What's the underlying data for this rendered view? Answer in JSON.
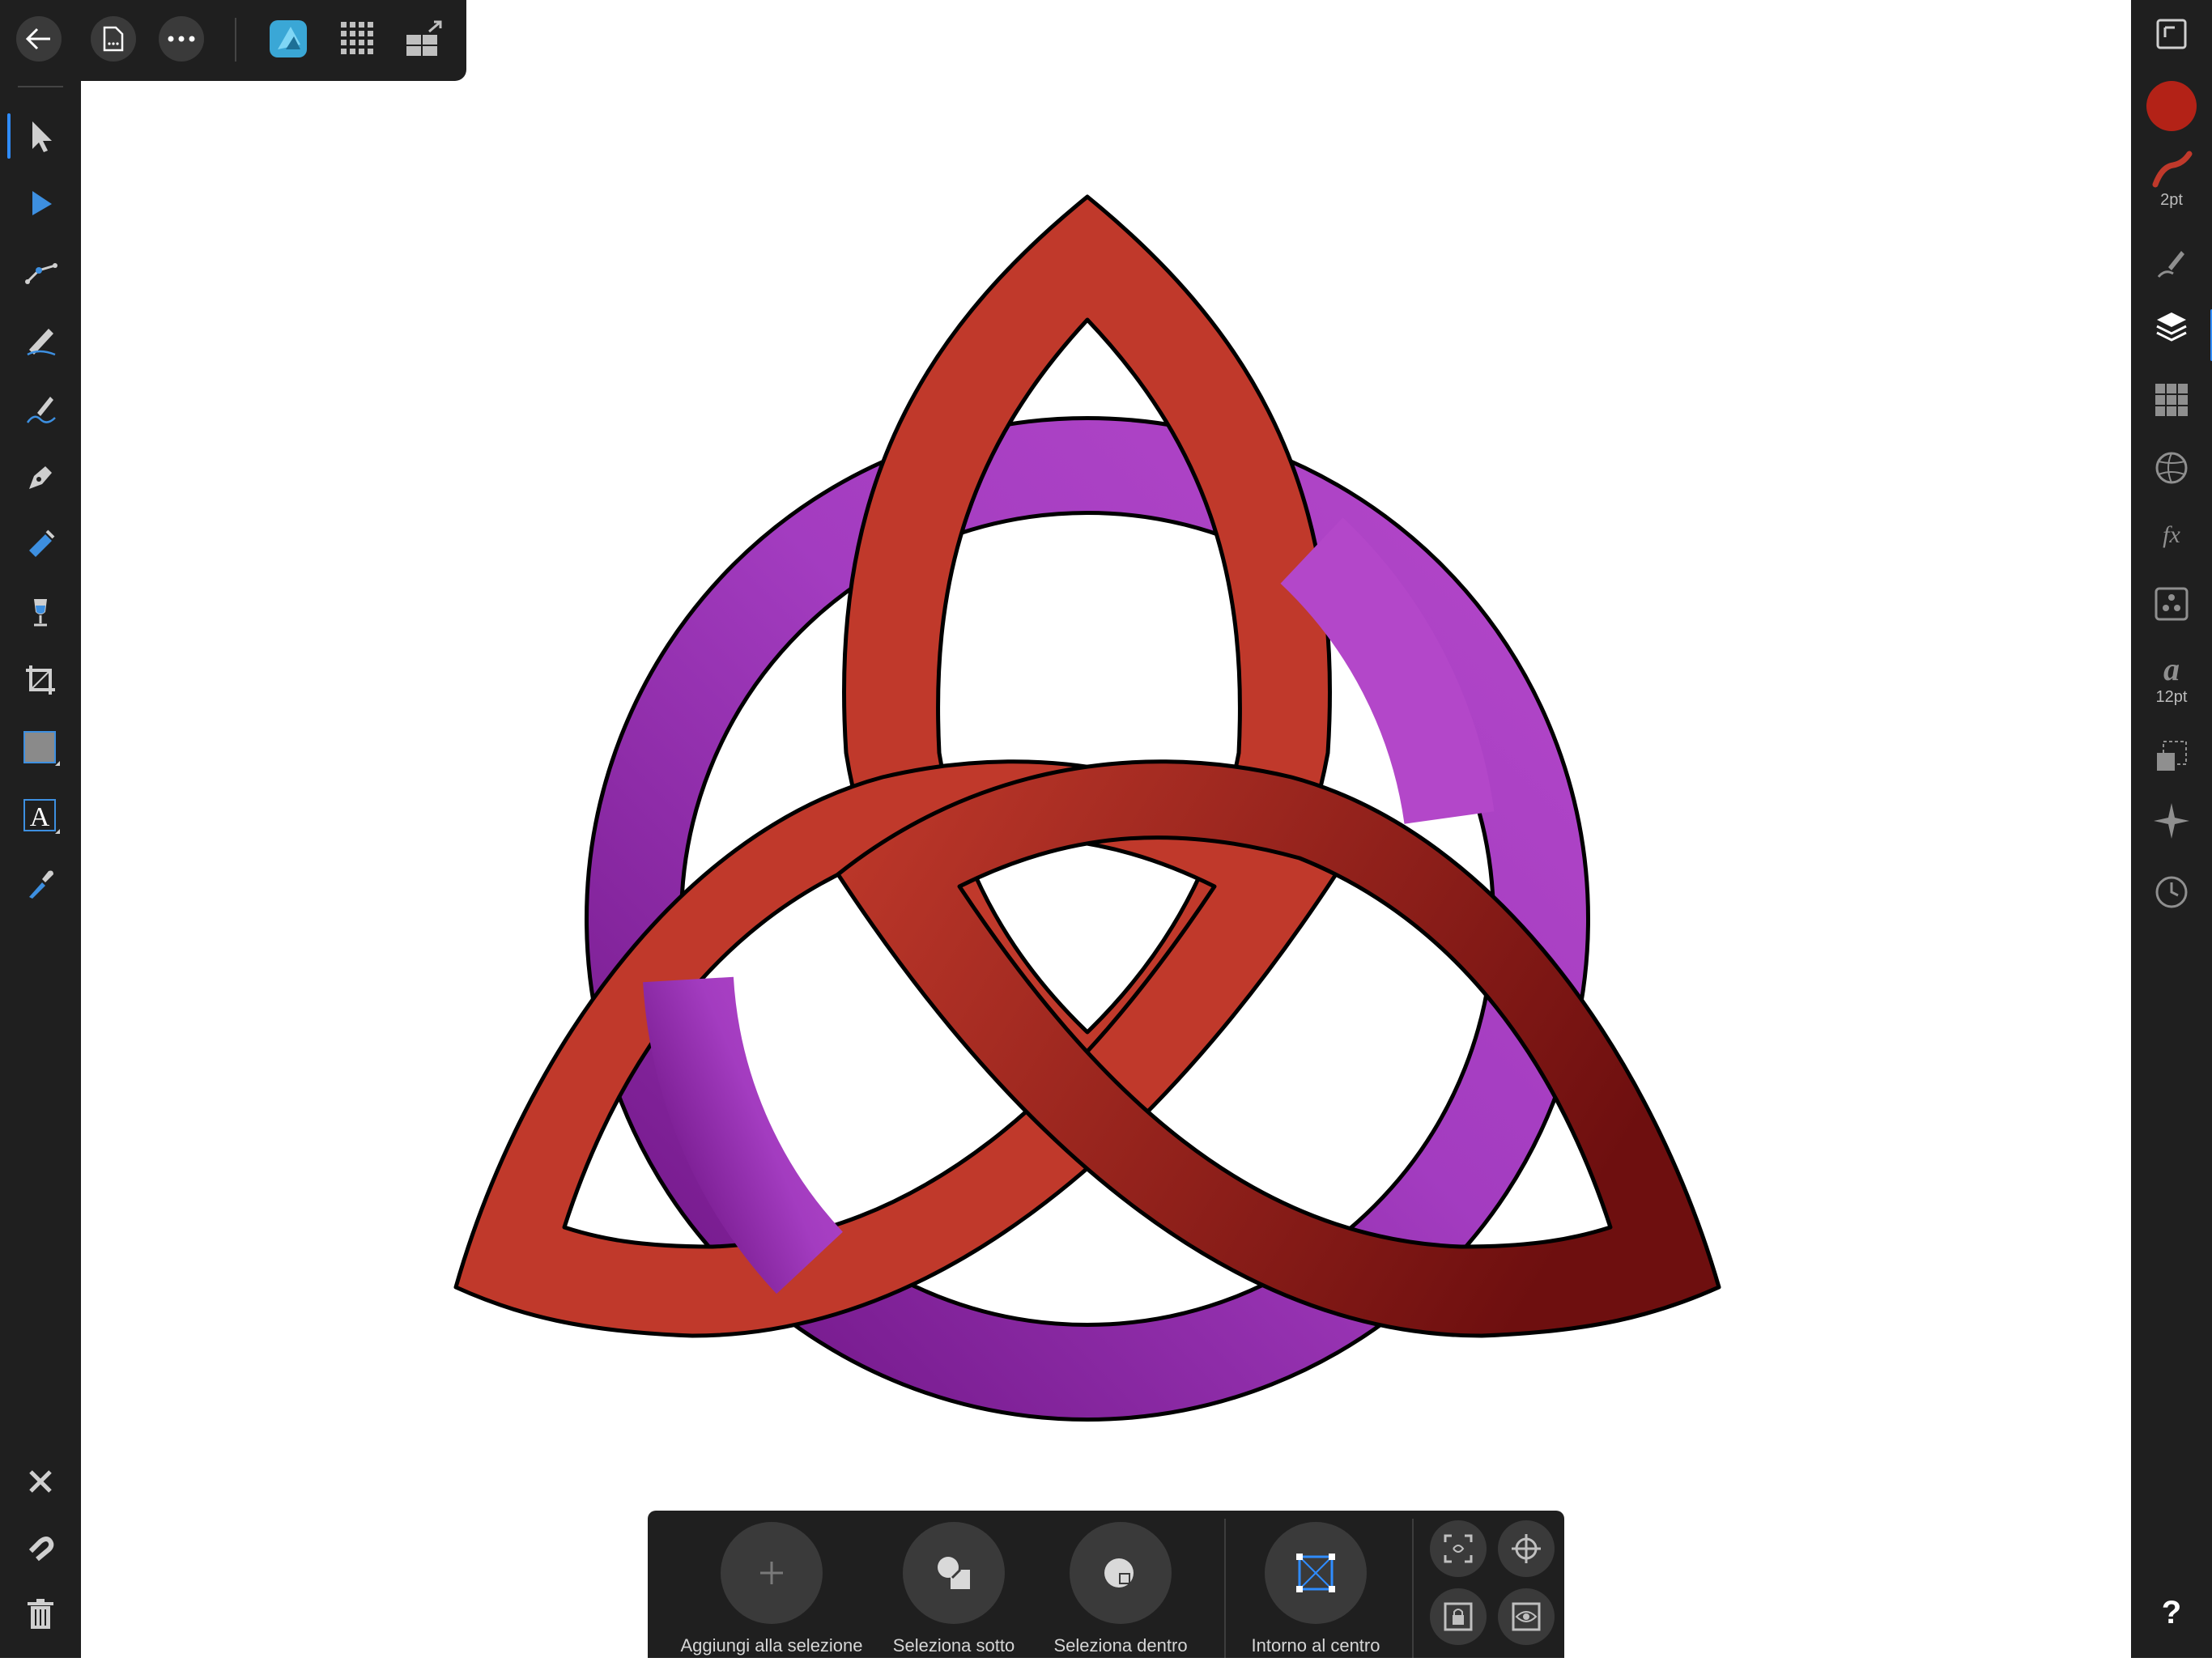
{
  "app": {
    "name": "Affinity Designer"
  },
  "right_panel": {
    "stroke_width_label": "2pt",
    "font_size_label": "12pt",
    "fill_color": "#b32217",
    "stroke_color": "#c0392b"
  },
  "bottom_bar": {
    "add_to_selection": "Aggiungi alla selezione",
    "select_under": "Seleziona sotto",
    "select_inside": "Seleziona dentro",
    "around_center": "Intorno al centro"
  },
  "help_label": "?",
  "artwork": {
    "title": "triquetra",
    "colors": {
      "red": "#c0392b",
      "dark_red": "#6e0f0f",
      "purple": "#b347c9",
      "dark_purple": "#7a1d8f",
      "outline": "#000000"
    }
  }
}
